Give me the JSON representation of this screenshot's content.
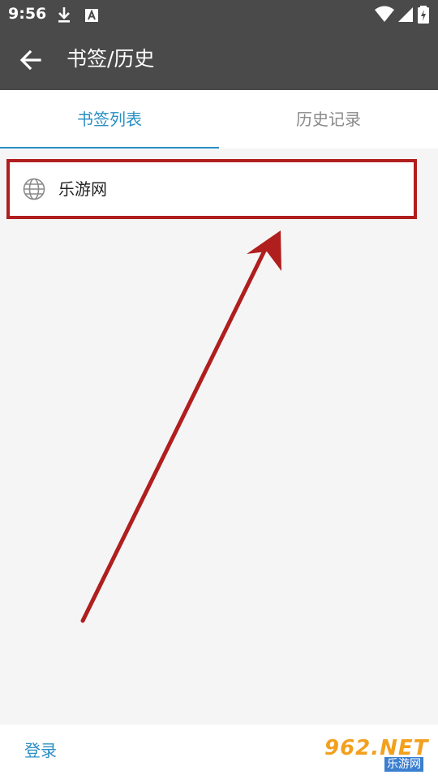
{
  "status_bar": {
    "time": "9:56",
    "left_icons": [
      "download-icon",
      "a-notification-icon"
    ],
    "right_icons": [
      "wifi-icon",
      "signal-icon",
      "battery-charging-icon"
    ]
  },
  "app_bar": {
    "title": "书签/历史",
    "back_icon": "arrow-back-icon"
  },
  "tabs": [
    {
      "label": "书签列表",
      "active": true
    },
    {
      "label": "历史记录",
      "active": false
    }
  ],
  "bookmarks": [
    {
      "label": "乐游网",
      "icon": "globe-icon"
    }
  ],
  "bottom_bar": {
    "login_label": "登录"
  },
  "watermark": {
    "logo": "962.NET",
    "sub": "乐游网"
  },
  "colors": {
    "app_bar": "#4a4a4a",
    "accent": "#2a8fc4",
    "annotation": "#b01e1e",
    "background": "#f5f5f5"
  }
}
